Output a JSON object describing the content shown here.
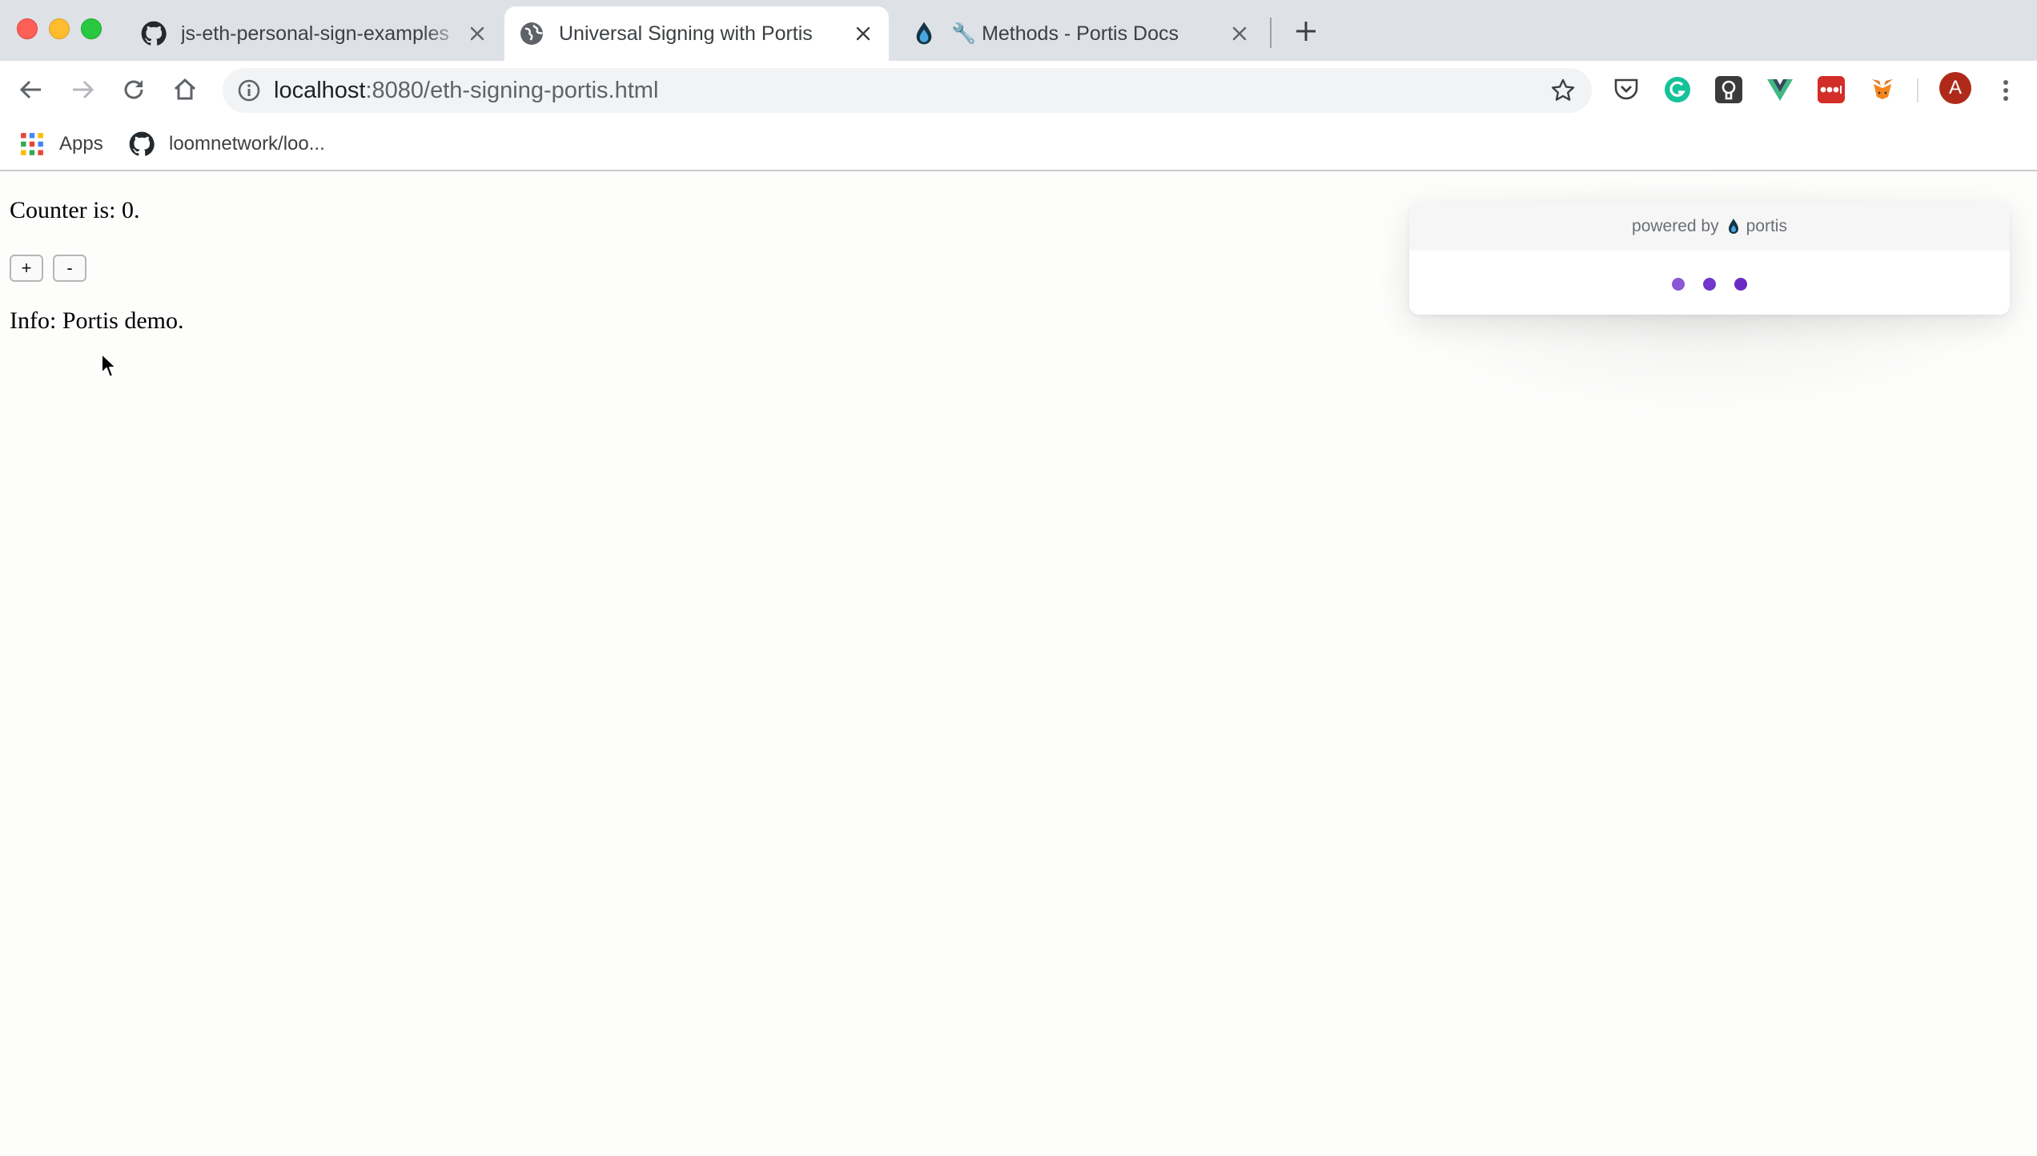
{
  "browser": {
    "tabs": [
      {
        "title": "js-eth-personal-sign-examples",
        "favicon": "github-icon",
        "active": false
      },
      {
        "title": "Universal Signing with Portis",
        "favicon": "globe-icon",
        "active": true
      },
      {
        "title": "🔧 Methods - Portis Docs",
        "favicon": "portis-drop-icon",
        "active": false
      }
    ],
    "url_host": "localhost",
    "url_rest": ":8080/eth-signing-portis.html",
    "bookmarks": [
      {
        "label": "Apps",
        "icon": "apps-grid-icon"
      },
      {
        "label": "loomnetwork/loo...",
        "icon": "github-icon"
      }
    ],
    "profile_initial": "A",
    "extensions": [
      "pocket-icon",
      "grammarly-icon",
      "keeper-icon",
      "vue-devtools-icon",
      "lastpass-icon",
      "metamask-icon"
    ]
  },
  "page": {
    "counter_text": "Counter is: 0.",
    "increment_label": "+",
    "decrement_label": "-",
    "info_text": "Info: Portis demo."
  },
  "portis": {
    "powered_by": "powered by",
    "brand": "portis",
    "loading_dot_colors": [
      "#8b57d6",
      "#7236cc",
      "#6a2bc4"
    ]
  }
}
